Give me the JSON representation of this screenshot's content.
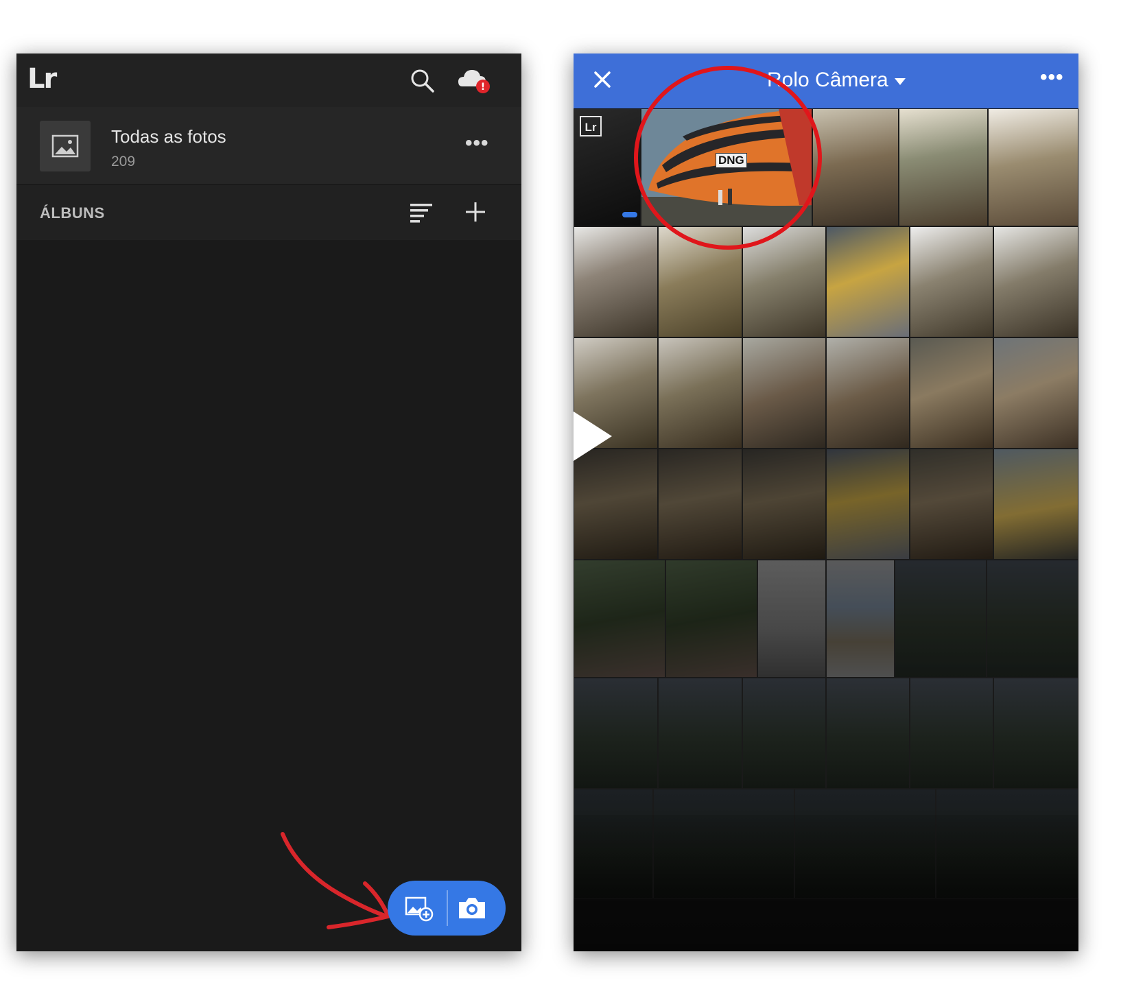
{
  "left_screen": {
    "header": {
      "logo": "Lr",
      "search_icon": "search-icon",
      "cloud_icon": "cloud-alert-icon",
      "cloud_badge": "!"
    },
    "all_photos": {
      "title": "Todas as fotos",
      "count": "209",
      "icon": "image-icon",
      "more_icon": "more-icon"
    },
    "albums": {
      "label": "ÁLBUNS",
      "sort_icon": "sort-icon",
      "add_icon": "plus-icon"
    },
    "fab": {
      "add_photos_icon": "add-photo-icon",
      "camera_icon": "camera-icon"
    },
    "annotation_color": "#d9262b"
  },
  "right_screen": {
    "header": {
      "close_icon": "close-icon",
      "title": "Rolo Câmera",
      "dropdown_icon": "caret-down-icon",
      "more_icon": "more-icon"
    },
    "featured_thumb": {
      "lr_badge": "Lr",
      "format_badge": "DNG"
    },
    "accent_color": "#3e6fd8",
    "highlight_color": "#e0161b"
  }
}
